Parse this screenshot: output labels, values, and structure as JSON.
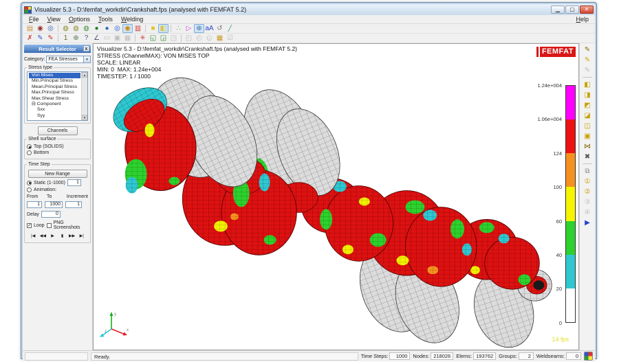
{
  "window": {
    "title": "Visualizer 5.3 - D:\\femfat_workdir\\Crankshaft.fps (analysed with FEMFAT 5.2)",
    "minimize": "▁",
    "maximize": "▢",
    "close": "✕"
  },
  "menu": {
    "items": [
      "File",
      "View",
      "Options",
      "Tools",
      "Welding"
    ],
    "help": "Help"
  },
  "toolbar_row1": [
    {
      "name": "open-results",
      "glyph": "▤",
      "c": "#c89440"
    },
    {
      "name": "snapshot",
      "glyph": "◉",
      "c": "#993333"
    },
    {
      "name": "record-movie",
      "glyph": "◎",
      "c": "#3366aa"
    },
    "|",
    {
      "name": "fit-view",
      "glyph": "◍",
      "c": "#8a8a2a"
    },
    {
      "name": "zoom-view",
      "glyph": "◍",
      "c": "#8a8a2a"
    },
    {
      "name": "rotate-view",
      "glyph": "◍",
      "c": "#3a8a3a"
    },
    {
      "name": "shaded-view",
      "glyph": "●",
      "c": "#2a7a2a"
    },
    {
      "name": "globe-view",
      "glyph": "●",
      "c": "#3366bb"
    },
    {
      "name": "contour-rings",
      "glyph": "◎",
      "c": "#2255cc"
    },
    {
      "name": "contour-target",
      "glyph": "◉",
      "c": "#cc8800",
      "pressed": true
    },
    {
      "name": "legend-bars",
      "glyph": "▥",
      "c": "#cc3333"
    },
    "|",
    {
      "name": "cube-solid",
      "glyph": "■",
      "c": "#e0c530"
    },
    {
      "name": "cube-feature",
      "glyph": "◧",
      "c": "#e0c530",
      "pressed": true
    },
    "|",
    {
      "name": "probe-points",
      "glyph": "∴",
      "c": "#33aa33"
    },
    {
      "name": "pick-element",
      "glyph": "▷",
      "c": "#cc44cc"
    },
    {
      "name": "wireframe-globe",
      "glyph": "⊕",
      "c": "#4466aa",
      "pressed": true
    },
    {
      "name": "annotation-text",
      "glyph": "aA",
      "c": "#2244cc"
    },
    {
      "name": "rotate-ccw",
      "glyph": "↺",
      "c": "#777777"
    },
    {
      "name": "measure-ruler",
      "glyph": "╱",
      "c": "#3aa06a"
    }
  ],
  "toolbar_row2": [
    {
      "name": "clear-marks",
      "glyph": "✗",
      "c": "#cc3333"
    },
    {
      "name": "marker-blue",
      "glyph": "✎",
      "c": "#3355cc"
    },
    {
      "name": "marker-red",
      "glyph": "✎",
      "c": "#cc3333"
    },
    "|",
    {
      "name": "node-id",
      "glyph": "1",
      "c": "#666633"
    },
    {
      "name": "rotate-center",
      "glyph": "⊕",
      "c": "#557755"
    },
    {
      "name": "query-node",
      "glyph": "?",
      "c": "#445588"
    },
    {
      "name": "measure-angle",
      "glyph": "∠",
      "c": "#555577"
    },
    {
      "name": "section-plane",
      "glyph": "▭",
      "c": "#999999",
      "disabled": true
    },
    {
      "name": "copy-image",
      "glyph": "▣",
      "c": "#999999",
      "disabled": true
    },
    {
      "name": "chart-window",
      "glyph": "▦",
      "c": "#999999",
      "disabled": true
    },
    "|",
    {
      "name": "mcf-node",
      "glyph": "✳",
      "c": "#cc4444"
    },
    {
      "name": "export-page-1",
      "glyph": "◱",
      "c": "#3a8a3a"
    },
    {
      "name": "export-page-2",
      "glyph": "◲",
      "c": "#3a8a3a"
    },
    {
      "name": "export-page-3",
      "glyph": "◳",
      "c": "#999999",
      "disabled": true
    },
    "|",
    {
      "name": "import-page-1",
      "glyph": "◰",
      "c": "#999999",
      "disabled": true
    },
    {
      "name": "import-page-2",
      "glyph": "◴",
      "c": "#999999",
      "disabled": true
    },
    {
      "name": "import-page-3",
      "glyph": "◵",
      "c": "#999999",
      "disabled": true
    },
    {
      "name": "calculator",
      "glyph": "▦",
      "c": "#cc9922"
    },
    {
      "name": "validate-check",
      "glyph": "☑",
      "c": "#999999",
      "disabled": true
    }
  ],
  "right_toolbar": [
    {
      "name": "edit-legend",
      "glyph": "✎",
      "c": "#996600"
    },
    {
      "name": "edit-annotation",
      "glyph": "✎",
      "c": "#ccaa00"
    },
    {
      "name": "edit-disabled",
      "glyph": "✎",
      "c": "#aaaaaa",
      "disabled": true
    },
    "|",
    {
      "name": "view-iso-1",
      "glyph": "◧",
      "c": "#c8a000"
    },
    {
      "name": "view-iso-2",
      "glyph": "◨",
      "c": "#c8a000"
    },
    {
      "name": "view-front",
      "glyph": "◩",
      "c": "#c8a000"
    },
    {
      "name": "view-back",
      "glyph": "◪",
      "c": "#c8a000"
    },
    {
      "name": "view-left",
      "glyph": "◫",
      "c": "#c8a000"
    },
    {
      "name": "view-right",
      "glyph": "▣",
      "c": "#c8a000"
    },
    {
      "name": "explode-view",
      "glyph": "⋈",
      "c": "#886600"
    },
    {
      "name": "reset-view",
      "glyph": "✖",
      "c": "#555555"
    },
    "|",
    {
      "name": "duplicate-view",
      "glyph": "⧉",
      "c": "#888888"
    },
    {
      "name": "stored-view-1",
      "glyph": "①",
      "c": "#cc9900"
    },
    {
      "name": "stored-view-2",
      "glyph": "②",
      "c": "#cc9900"
    },
    {
      "name": "stored-view-3",
      "glyph": "③",
      "c": "#bbbbbb",
      "disabled": true
    },
    {
      "name": "stored-view-4",
      "glyph": "④",
      "c": "#bbbbbb",
      "disabled": true
    },
    {
      "name": "present-mode",
      "glyph": "▶",
      "c": "#2244cc"
    }
  ],
  "result_selector": {
    "title": "Result Selector",
    "close_glyph": "x",
    "category_label": "Category:",
    "category_value": "FEA Stresses",
    "stress_group_label": "Stress type",
    "stress_types": [
      "Von Mises",
      "Min.Principal Stress",
      "Mean.Principal Stress",
      "Max.Principal Stress",
      "Max.Shear Stress",
      "⊟ Component",
      "Sxx",
      "Syy"
    ],
    "selected_stress": "Von Mises",
    "channels_button": "Channels",
    "shell_surface": {
      "label": "Shell surface",
      "top_option": "Top (SOLIDS)",
      "bottom_option": "Bottom",
      "selected": "Top (SOLIDS)"
    },
    "time_step": {
      "label": "Time Step",
      "new_range_button": "New Range",
      "static_label": "Static (1-1000)",
      "static_value": "1",
      "animation_label": "Animation:",
      "from_label": "From",
      "to_label": "To",
      "increment_label": "Increment",
      "from_value": "1",
      "to_value": "1000",
      "increment_value": "1",
      "delay_label": "Delay",
      "delay_value": "0",
      "loop_label": "Loop",
      "png_label": "PNG Screenshots",
      "media_buttons": [
        {
          "name": "first-step",
          "glyph": "|◀",
          "c": "#222222"
        },
        {
          "name": "rewind-step",
          "glyph": "◀◀",
          "c": "#222222"
        },
        {
          "name": "play-steps",
          "glyph": "▶",
          "c": "#222222"
        },
        {
          "name": "pause-steps",
          "glyph": "▮",
          "c": "#222222"
        },
        {
          "name": "forward-step",
          "glyph": "▶▶",
          "c": "#222222"
        },
        {
          "name": "last-step",
          "glyph": "▶|",
          "c": "#222222"
        }
      ]
    }
  },
  "viewport": {
    "header_lines": [
      "Visualizer 5.3 - D:\\femfat_workdir\\Crankshaft.fps (analysed with FEMFAT 5.2)",
      "STRESS (ChannelMAX): VON MISES TOP",
      "SCALE: LINEAR",
      "MIN: 0  MAX: 1.24e+004",
      "TIMESTEP: 1 / 1000"
    ],
    "logo_text": "FEMFAT",
    "fps": "14 fps",
    "colorbar": {
      "labels": [
        "1.24e+004",
        "1.06e+004",
        "124",
        "100",
        "60",
        "40",
        "20",
        "0"
      ],
      "colors": [
        "#ff00ff",
        "#ee1111",
        "#f59120",
        "#f5f500",
        "#2ed12e",
        "#2fc8d0",
        "#ffffff"
      ]
    },
    "triad_labels": {
      "x": "x",
      "y": "y",
      "z": "z"
    }
  },
  "statusbar": {
    "ready": "Ready.",
    "fields": [
      {
        "label": "Time Steps:",
        "value": "1000"
      },
      {
        "label": "Nodes:",
        "value": "218026"
      },
      {
        "label": "Elems:",
        "value": "193762"
      },
      {
        "label": "Groups:",
        "value": "2"
      },
      {
        "label": "Weldseams:",
        "value": "0"
      }
    ]
  }
}
